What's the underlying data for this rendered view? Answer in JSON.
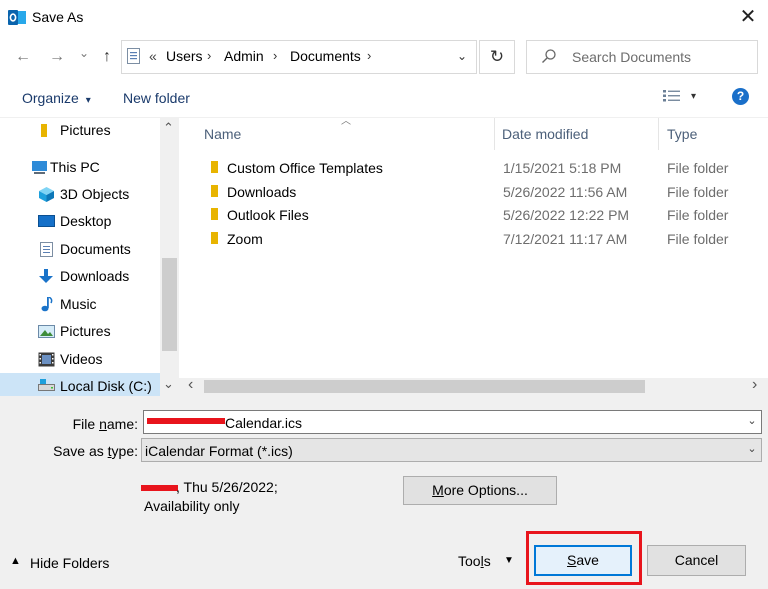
{
  "window": {
    "title": "Save As",
    "close_glyph": "✕"
  },
  "nav": {
    "back_glyph": "←",
    "forward_glyph": "→",
    "history_glyph": "⌄",
    "up_glyph": "↑",
    "refresh_glyph": "↻"
  },
  "address": {
    "overflow": "«",
    "crumbs": [
      "Users",
      "Admin",
      "Documents"
    ],
    "sep": "›",
    "dropdown_glyph": "⌄"
  },
  "search": {
    "placeholder": "Search Documents"
  },
  "toolbar": {
    "organize_label": "Organize",
    "organize_arrow": "▾",
    "new_folder_label": "New folder",
    "view_arrow": "▾",
    "help_label": "?"
  },
  "sidebar": {
    "items": [
      {
        "label": "Pictures",
        "icon": "folder-icon"
      },
      {
        "label": "This PC",
        "icon": "pc-icon"
      },
      {
        "label": "3D Objects",
        "icon": "3d-objects-icon"
      },
      {
        "label": "Desktop",
        "icon": "desktop-icon"
      },
      {
        "label": "Documents",
        "icon": "documents-icon"
      },
      {
        "label": "Downloads",
        "icon": "downloads-icon"
      },
      {
        "label": "Music",
        "icon": "music-icon"
      },
      {
        "label": "Pictures",
        "icon": "pictures-icon"
      },
      {
        "label": "Videos",
        "icon": "videos-icon"
      },
      {
        "label": "Local Disk (C:)",
        "icon": "drive-icon"
      }
    ],
    "scroll_up": "⌃",
    "scroll_down": "⌄"
  },
  "filelist": {
    "columns": {
      "name": "Name",
      "date": "Date modified",
      "type": "Type"
    },
    "sort_glyph": "︿",
    "rows": [
      {
        "name": "Custom Office Templates",
        "date": "1/15/2021 5:18 PM",
        "type": "File folder"
      },
      {
        "name": "Downloads",
        "date": "5/26/2022 11:56 AM",
        "type": "File folder"
      },
      {
        "name": "Outlook Files",
        "date": "5/26/2022 12:22 PM",
        "type": "File folder"
      },
      {
        "name": "Zoom",
        "date": "7/12/2021 11:17 AM",
        "type": "File folder"
      }
    ],
    "scroll_left": "‹",
    "scroll_right": "›"
  },
  "form": {
    "filename_label_pre": "File ",
    "filename_label_u": "n",
    "filename_label_post": "ame:",
    "filename_value": "Calendar.ics",
    "savetype_label_pre": "Save as ",
    "savetype_label_u": "t",
    "savetype_label_post": "ype:",
    "savetype_value": "iCalendar Format (*.ics)",
    "dd_glyph": "⌄",
    "info_line1": ", Thu 5/26/2022;",
    "info_line2": "Availability only",
    "more_options_u": "M",
    "more_options_rest": "ore Options..."
  },
  "footer": {
    "hide_folders_glyph": "▲",
    "hide_folders_label": "Hide Folders",
    "tools_pre": "Too",
    "tools_u": "l",
    "tools_post": "s",
    "tools_arrow": "▼",
    "save_u": "S",
    "save_rest": "ave",
    "cancel_label": "Cancel"
  },
  "colors": {
    "accent": "#1a6fc9",
    "highlight_border": "#e8141c",
    "selected_bg": "#cce4f7",
    "save_button_border": "#0078d7",
    "folder_yellow": "#e8b400"
  }
}
